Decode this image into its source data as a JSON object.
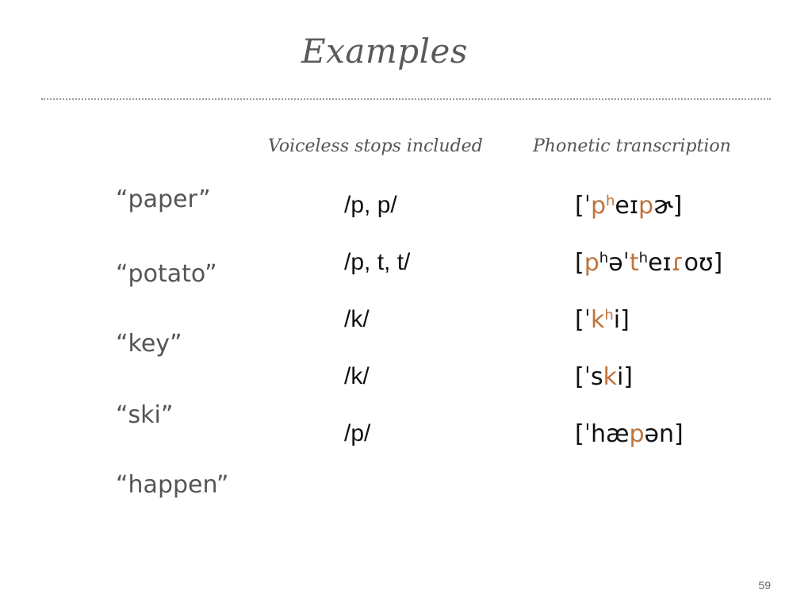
{
  "slide": {
    "title": "Examples",
    "page_number": "59"
  },
  "columns": {
    "stops_header": "Voiceless stops included",
    "phonetic_header": "Phonetic transcription"
  },
  "examples": [
    {
      "word": "“paper”",
      "stops": "/p, p/",
      "transcription": [
        {
          "t": "[ˈ",
          "hl": false
        },
        {
          "t": "p",
          "hl": true
        },
        {
          "t": "h",
          "hl": true,
          "sup": true
        },
        {
          "t": "eɪ",
          "hl": false
        },
        {
          "t": "p",
          "hl": true
        },
        {
          "t": "ɚ]",
          "hl": false
        }
      ]
    },
    {
      "word": "“potato”",
      "stops": "/p, t, t/",
      "transcription": [
        {
          "t": "[",
          "hl": false
        },
        {
          "t": "p",
          "hl": true
        },
        {
          "t": "h",
          "hl": false,
          "sup": true
        },
        {
          "t": "əˈ",
          "hl": false
        },
        {
          "t": "t",
          "hl": true
        },
        {
          "t": "h",
          "hl": false,
          "sup": true
        },
        {
          "t": "eɪ",
          "hl": false
        },
        {
          "t": "ɾ",
          "hl": true
        },
        {
          "t": "oʊ]",
          "hl": false
        }
      ]
    },
    {
      "word": "“key”",
      "stops": "/k/",
      "transcription": [
        {
          "t": "[ˈ",
          "hl": false
        },
        {
          "t": "k",
          "hl": true
        },
        {
          "t": "h",
          "hl": true,
          "sup": true
        },
        {
          "t": "i]",
          "hl": false
        }
      ]
    },
    {
      "word": "“ski”",
      "stops": "/k/",
      "transcription": [
        {
          "t": "[ˈs",
          "hl": false
        },
        {
          "t": "k",
          "hl": true
        },
        {
          "t": "i]",
          "hl": false
        }
      ]
    },
    {
      "word": "“happen”",
      "stops": "/p/",
      "transcription": [
        {
          "t": "[ˈhæ",
          "hl": false
        },
        {
          "t": "p",
          "hl": true
        },
        {
          "t": "ən]",
          "hl": false
        }
      ]
    }
  ],
  "colors": {
    "highlight": "#c0733a",
    "word_text": "#555555",
    "body_text": "#111111"
  }
}
